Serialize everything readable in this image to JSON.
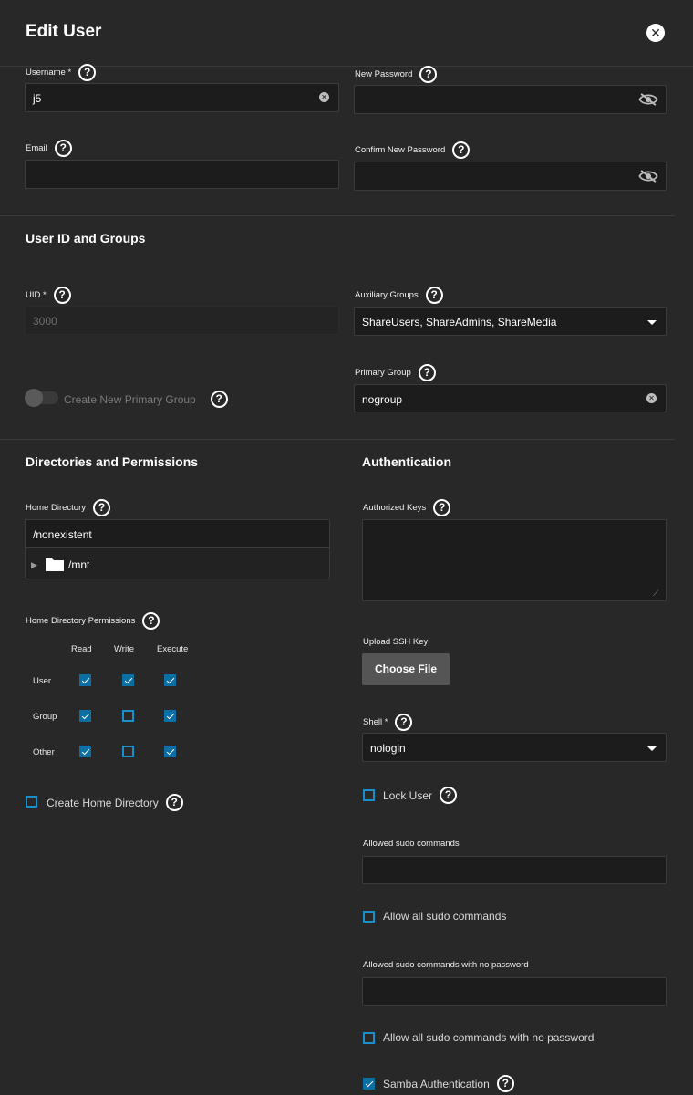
{
  "dialog": {
    "title": "Edit User"
  },
  "identity": {
    "username_label": "Username *",
    "username_value": "j5",
    "new_password_label": "New Password",
    "email_label": "Email",
    "email_value": "",
    "confirm_password_label": "Confirm New Password"
  },
  "uid_groups": {
    "section_title": "User ID and Groups",
    "uid_label": "UID *",
    "uid_value": "3000",
    "aux_groups_label": "Auxiliary Groups",
    "aux_groups_value": "ShareUsers, ShareAdmins, ShareMedia",
    "create_primary_group_label": "Create New Primary Group",
    "primary_group_label": "Primary Group",
    "primary_group_value": "nogroup"
  },
  "directories": {
    "section_title": "Directories and Permissions",
    "home_dir_label": "Home Directory",
    "home_dir_value": "/nonexistent",
    "tree_item": "/mnt",
    "permissions_label": "Home Directory Permissions",
    "columns": [
      "Read",
      "Write",
      "Execute"
    ],
    "rows": [
      {
        "name": "User",
        "read": true,
        "write": true,
        "execute": true
      },
      {
        "name": "Group",
        "read": true,
        "write": false,
        "execute": true
      },
      {
        "name": "Other",
        "read": true,
        "write": false,
        "execute": true
      }
    ],
    "create_home_label": "Create Home Directory",
    "create_home_checked": false
  },
  "authentication": {
    "section_title": "Authentication",
    "authorized_keys_label": "Authorized Keys",
    "upload_ssh_label": "Upload SSH Key",
    "choose_file_label": "Choose File",
    "shell_label": "Shell *",
    "shell_value": "nologin",
    "lock_user_label": "Lock User",
    "lock_user_checked": false,
    "sudo_commands_label": "Allowed sudo commands",
    "allow_all_sudo_label": "Allow all sudo commands",
    "allow_all_sudo_checked": false,
    "sudo_nopass_label": "Allowed sudo commands with no password",
    "allow_all_sudo_nopass_label": "Allow all sudo commands with no password",
    "allow_all_sudo_nopass_checked": false,
    "samba_auth_label": "Samba Authentication",
    "samba_auth_checked": true
  },
  "icons": {
    "help": "help-circle-icon",
    "close": "close-icon",
    "clear": "clear-icon",
    "visibility_off": "eye-off-icon",
    "dropdown": "caret-down-icon",
    "folder": "folder-icon",
    "expand": "chevron-right-icon"
  },
  "colors": {
    "accent": "#0b6fa4",
    "background": "#282828",
    "field": "#1c1c1c"
  }
}
